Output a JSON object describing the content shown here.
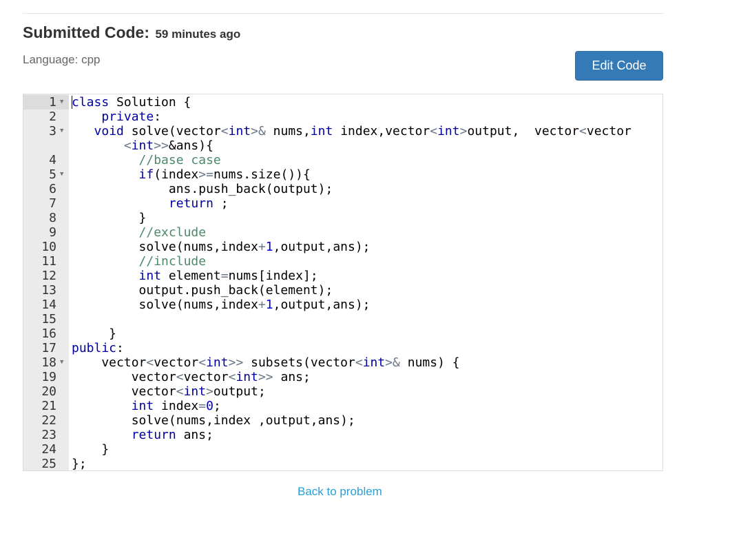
{
  "header": {
    "title": "Submitted Code:",
    "time": "59 minutes ago",
    "language": "Language: cpp",
    "edit_label": "Edit Code"
  },
  "footer": {
    "back_label": "Back to problem"
  },
  "colors": {
    "button": "#337ab7",
    "link": "#2a9fd6",
    "keyword": "#0000a2",
    "comment": "#4c886b",
    "number": "#0000cd",
    "operator": "#687687"
  },
  "code": [
    {
      "n": "1",
      "fold": true,
      "tokens": [
        [
          "kw",
          "class"
        ],
        [
          "t",
          " Solution {"
        ]
      ]
    },
    {
      "n": "2",
      "tokens": [
        [
          "t",
          "    "
        ],
        [
          "kw",
          "private"
        ],
        [
          "t",
          ":"
        ]
      ]
    },
    {
      "n": "3",
      "fold": true,
      "tokens": [
        [
          "t",
          "   "
        ],
        [
          "kw",
          "void"
        ],
        [
          "t",
          " solve(vector"
        ],
        [
          "op",
          "<"
        ],
        [
          "kw",
          "int"
        ],
        [
          "op",
          ">&"
        ],
        [
          "t",
          " nums,"
        ],
        [
          "kw",
          "int"
        ],
        [
          "t",
          " index,vector"
        ],
        [
          "op",
          "<"
        ],
        [
          "kw",
          "int"
        ],
        [
          "op",
          ">"
        ],
        [
          "t",
          "output,  vector"
        ],
        [
          "op",
          "<"
        ],
        [
          "t",
          "vector"
        ]
      ],
      "cont": [
        [
          "t",
          "       "
        ],
        [
          "op",
          "<"
        ],
        [
          "kw",
          "int"
        ],
        [
          "op",
          ">>"
        ],
        [
          "t",
          "&ans){"
        ]
      ]
    },
    {
      "n": "4",
      "tokens": [
        [
          "t",
          "         "
        ],
        [
          "cm",
          "//base case"
        ]
      ]
    },
    {
      "n": "5",
      "fold": true,
      "tokens": [
        [
          "t",
          "         "
        ],
        [
          "kw",
          "if"
        ],
        [
          "t",
          "(index"
        ],
        [
          "op",
          ">="
        ],
        [
          "t",
          "nums.size()){"
        ]
      ]
    },
    {
      "n": "6",
      "tokens": [
        [
          "t",
          "             ans.push_back(output);"
        ]
      ]
    },
    {
      "n": "7",
      "tokens": [
        [
          "t",
          "             "
        ],
        [
          "kw",
          "return"
        ],
        [
          "t",
          " ;"
        ]
      ]
    },
    {
      "n": "8",
      "tokens": [
        [
          "t",
          "         }"
        ]
      ]
    },
    {
      "n": "9",
      "tokens": [
        [
          "t",
          "         "
        ],
        [
          "cm",
          "//exclude"
        ]
      ]
    },
    {
      "n": "10",
      "tokens": [
        [
          "t",
          "         solve(nums,index"
        ],
        [
          "op",
          "+"
        ],
        [
          "num",
          "1"
        ],
        [
          "t",
          ",output,ans);"
        ]
      ]
    },
    {
      "n": "11",
      "tokens": [
        [
          "t",
          "         "
        ],
        [
          "cm",
          "//include"
        ]
      ]
    },
    {
      "n": "12",
      "tokens": [
        [
          "t",
          "         "
        ],
        [
          "kw",
          "int"
        ],
        [
          "t",
          " element"
        ],
        [
          "op",
          "="
        ],
        [
          "t",
          "nums[index];"
        ]
      ]
    },
    {
      "n": "13",
      "tokens": [
        [
          "t",
          "         output.push_back(element);"
        ]
      ]
    },
    {
      "n": "14",
      "tokens": [
        [
          "t",
          "         solve(nums,index"
        ],
        [
          "op",
          "+"
        ],
        [
          "num",
          "1"
        ],
        [
          "t",
          ",output,ans);"
        ]
      ]
    },
    {
      "n": "15",
      "tokens": [
        [
          "t",
          ""
        ]
      ]
    },
    {
      "n": "16",
      "tokens": [
        [
          "t",
          "     }"
        ]
      ]
    },
    {
      "n": "17",
      "tokens": [
        [
          "kw",
          "public"
        ],
        [
          "t",
          ":"
        ]
      ]
    },
    {
      "n": "18",
      "fold": true,
      "tokens": [
        [
          "t",
          "    vector"
        ],
        [
          "op",
          "<"
        ],
        [
          "t",
          "vector"
        ],
        [
          "op",
          "<"
        ],
        [
          "kw",
          "int"
        ],
        [
          "op",
          ">>"
        ],
        [
          "t",
          " subsets(vector"
        ],
        [
          "op",
          "<"
        ],
        [
          "kw",
          "int"
        ],
        [
          "op",
          ">&"
        ],
        [
          "t",
          " nums) {"
        ]
      ]
    },
    {
      "n": "19",
      "tokens": [
        [
          "t",
          "        vector"
        ],
        [
          "op",
          "<"
        ],
        [
          "t",
          "vector"
        ],
        [
          "op",
          "<"
        ],
        [
          "kw",
          "int"
        ],
        [
          "op",
          ">>"
        ],
        [
          "t",
          " ans;"
        ]
      ]
    },
    {
      "n": "20",
      "tokens": [
        [
          "t",
          "        vector"
        ],
        [
          "op",
          "<"
        ],
        [
          "kw",
          "int"
        ],
        [
          "op",
          ">"
        ],
        [
          "t",
          "output;"
        ]
      ]
    },
    {
      "n": "21",
      "tokens": [
        [
          "t",
          "        "
        ],
        [
          "kw",
          "int"
        ],
        [
          "t",
          " index"
        ],
        [
          "op",
          "="
        ],
        [
          "num",
          "0"
        ],
        [
          "t",
          ";"
        ]
      ]
    },
    {
      "n": "22",
      "tokens": [
        [
          "t",
          "        solve(nums,index ,output,ans);"
        ]
      ]
    },
    {
      "n": "23",
      "tokens": [
        [
          "t",
          "        "
        ],
        [
          "kw",
          "return"
        ],
        [
          "t",
          " ans;"
        ]
      ]
    },
    {
      "n": "24",
      "tokens": [
        [
          "t",
          "    }"
        ]
      ]
    },
    {
      "n": "25",
      "tokens": [
        [
          "t",
          "};"
        ]
      ]
    }
  ]
}
